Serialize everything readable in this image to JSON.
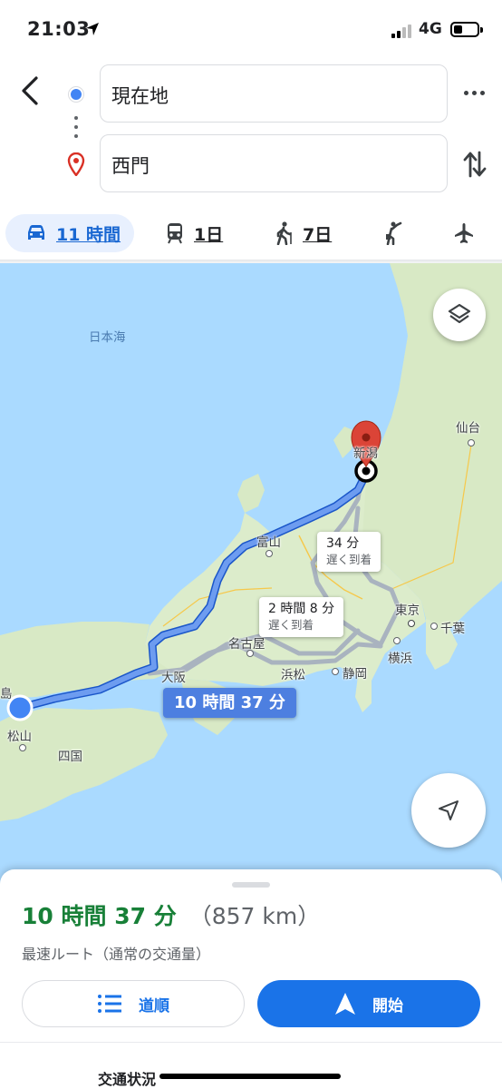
{
  "status_bar": {
    "time": "21:03",
    "network": "4G"
  },
  "route": {
    "origin": "現在地",
    "destination": "西門"
  },
  "modes": [
    {
      "id": "car",
      "icon": "car-icon",
      "label": "11 時間",
      "selected": true
    },
    {
      "id": "transit",
      "icon": "train-icon",
      "label": "1日"
    },
    {
      "id": "walk",
      "icon": "walk-icon",
      "label": "7日"
    },
    {
      "id": "ride",
      "icon": "ride-hailing-icon"
    },
    {
      "id": "flight",
      "icon": "airplane-icon"
    }
  ],
  "map": {
    "labels": {
      "sea": "日本海",
      "sendai": "仙台",
      "niigata": "新潟",
      "toyama": "富山",
      "tokyo": "東京",
      "chiba": "千葉",
      "yokohama": "横浜",
      "nagoya": "名古屋",
      "osaka": "大阪",
      "hamamatsu": "浜松",
      "shizuoka": "静岡",
      "matsuyama": "松山",
      "shikoku": "四国",
      "edge": "島"
    },
    "route_callouts": {
      "alt1_time": "34 分",
      "alt1_note": "遅く到着",
      "alt2_time": "2 時間 8 分",
      "alt2_note": "遅く到着",
      "main_time": "10 時間 37 分"
    },
    "colors": {
      "route": "#4d7fe0",
      "alt_route": "#a9b3bf",
      "water": "#aadaff",
      "land": "#d8e9c5"
    }
  },
  "sheet": {
    "duration": "10 時間 37 分",
    "distance": "（857 km）",
    "description": "最速ルート（通常の交通量）",
    "steps_label": "道順",
    "start_label": "開始",
    "traffic_label": "交通状況"
  }
}
